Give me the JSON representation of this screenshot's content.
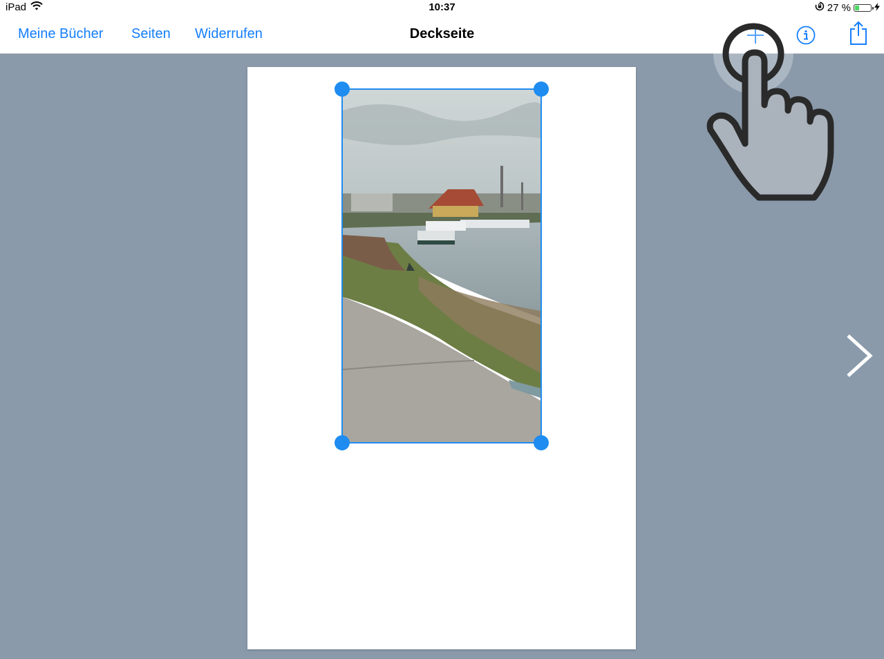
{
  "status_bar": {
    "device": "iPad",
    "time": "10:37",
    "battery_percent": "27 %",
    "battery_level": 0.27,
    "wifi_icon": "wifi-icon",
    "rotation_lock_icon": "rotation-lock-icon",
    "charging_icon": "bolt-icon"
  },
  "nav_bar": {
    "my_books": "Meine Bücher",
    "pages": "Seiten",
    "undo": "Widerrufen",
    "title": "Deckseite",
    "add_icon": "plus-icon",
    "info_icon": "info-icon",
    "share_icon": "share-icon"
  },
  "canvas": {
    "next_icon": "chevron-right-icon",
    "image_subject": "river-landscape-photo"
  },
  "colors": {
    "accent": "#147efb",
    "selection": "#1e8cf0",
    "background": "#8a9aaa",
    "battery_fill": "#4cd964"
  }
}
